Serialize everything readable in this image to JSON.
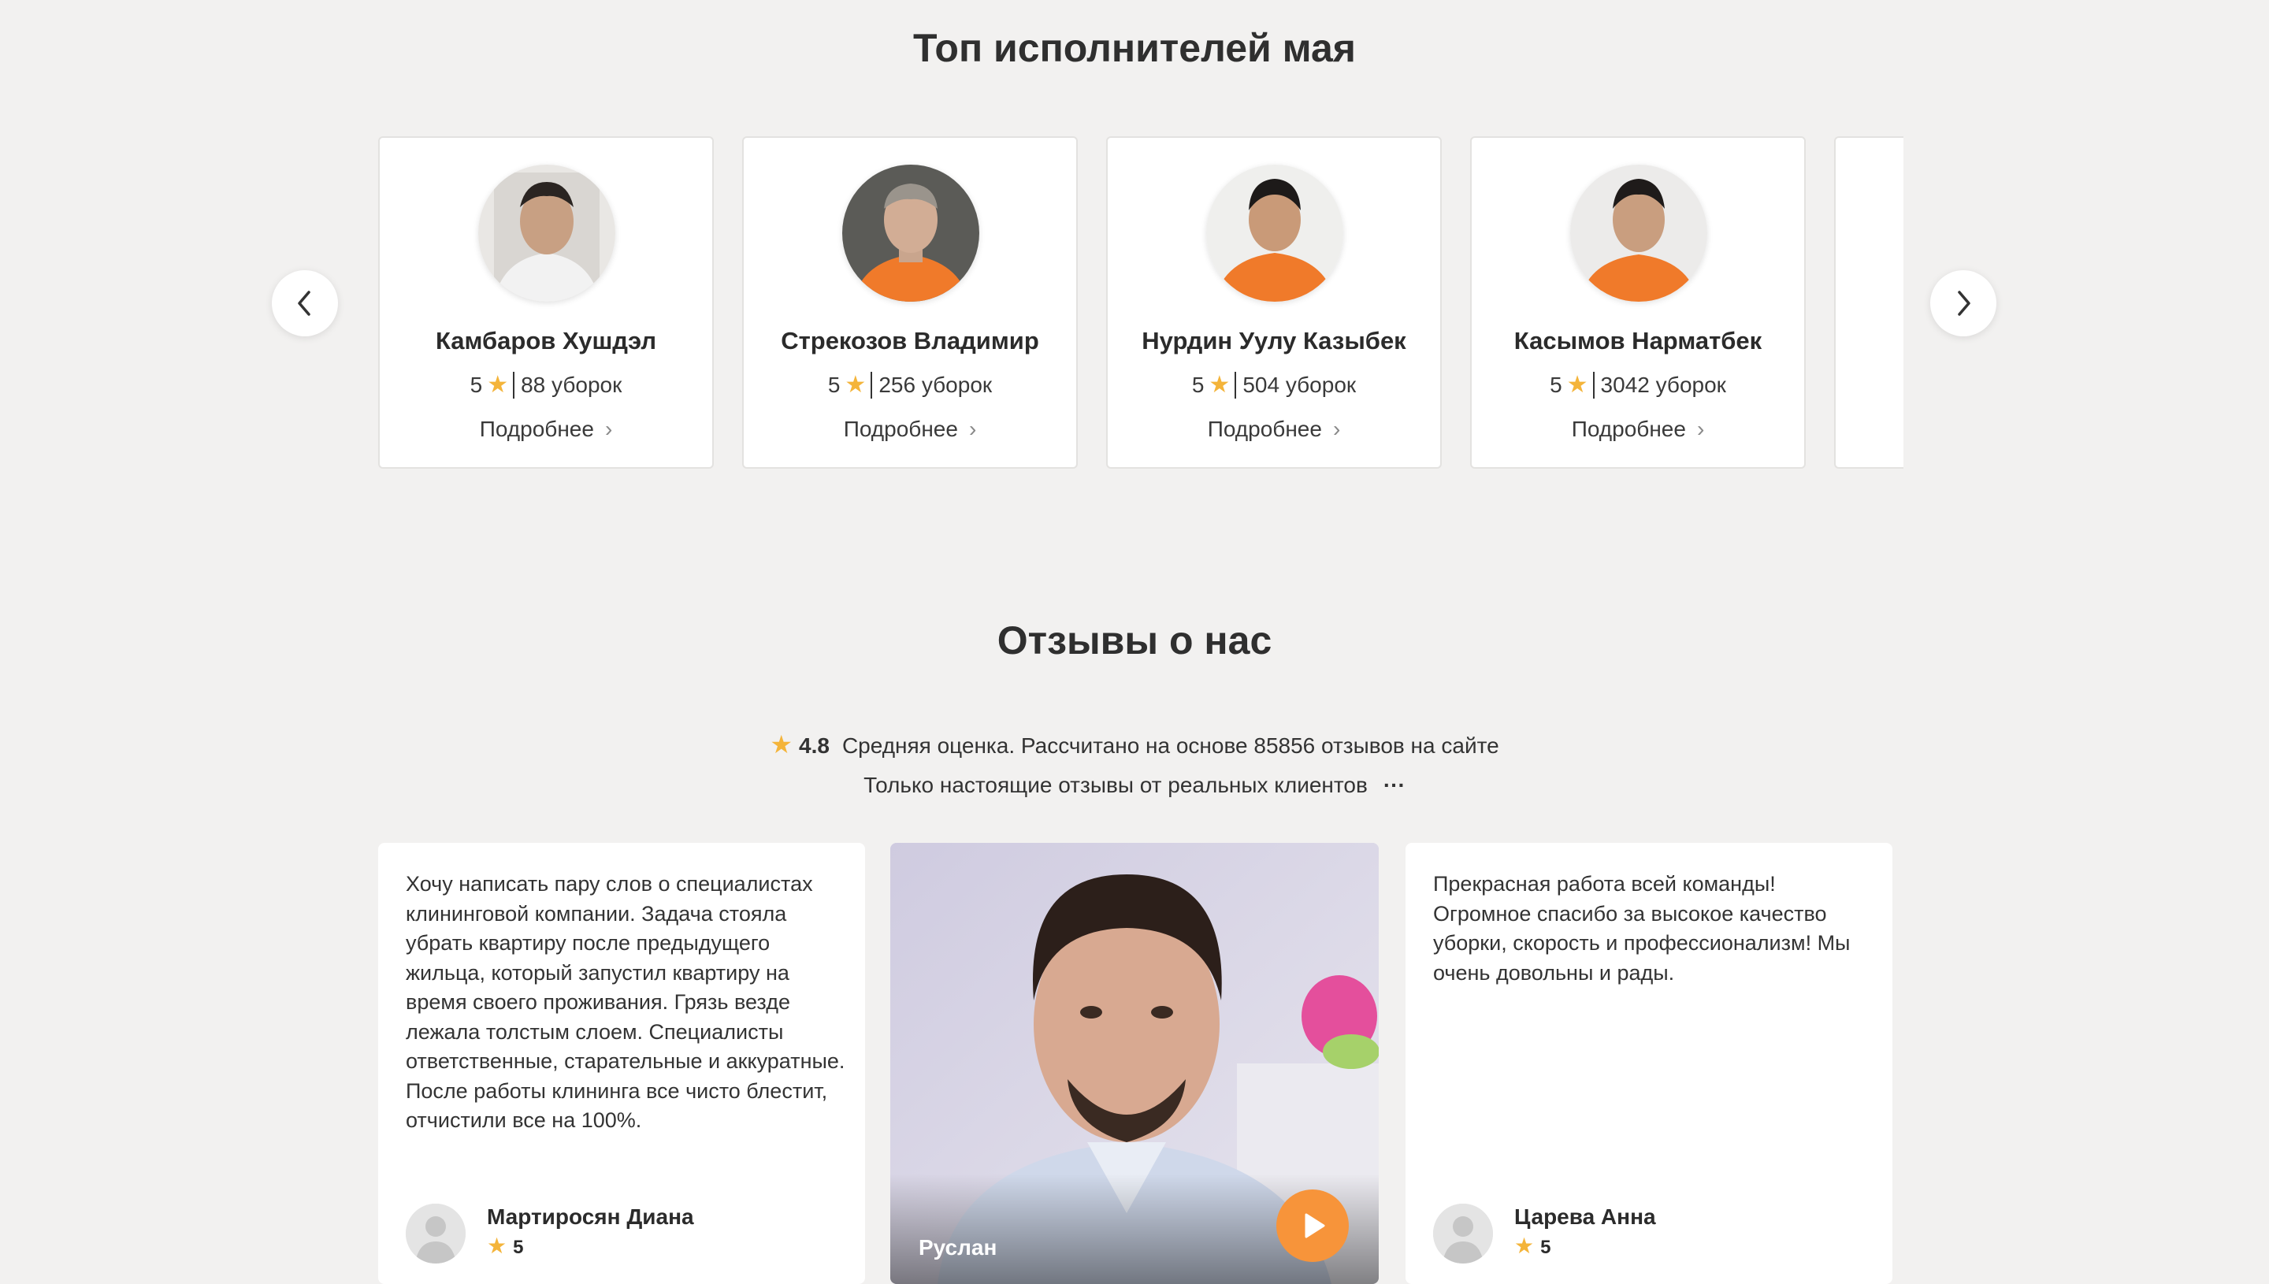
{
  "top_section": {
    "title": "Топ исполнителей мая",
    "performers": [
      {
        "name": "Камбаров Хушдэл",
        "rating": "5",
        "count": "88 уборок",
        "more": "Подробнее",
        "shirt_color": "#f2f2f2"
      },
      {
        "name": "Стрекозов Владимир",
        "rating": "5",
        "count": "256 уборок",
        "more": "Подробнее",
        "shirt_color": "#f07a2a"
      },
      {
        "name": "Нурдин Уулу Казыбек",
        "rating": "5",
        "count": "504 уборок",
        "more": "Подробнее",
        "shirt_color": "#f07a2a"
      },
      {
        "name": "Касымов Нарматбек",
        "rating": "5",
        "count": "3042 уборок",
        "more": "Подробнее",
        "shirt_color": "#f07a2a"
      }
    ],
    "prev_icon": "chevron-left-icon",
    "next_icon": "chevron-right-icon"
  },
  "reviews_section": {
    "title": "Отзывы о нас",
    "average": "4.8",
    "average_text": "Средняя оценка. Рассчитано на основе 85856 отзывов на сайте",
    "genuine_text": "Только настоящие отзывы от реальных клиентов",
    "more_icon": "···",
    "reviews": [
      {
        "text": "Хочу написать пару слов о специалистах клининговой компании. Задача стояла убрать квартиру после предыдущего жильца, который запустил квартиру на время своего проживания. Грязь везде лежала толстым слоем. Специалисты ответственные, старательные и аккуратные. После работы клининга все чисто блестит, отчистили все на 100%.",
        "author": "Мартиросян Диана",
        "rating": "5"
      },
      {
        "video_author": "Руслан"
      },
      {
        "text": "Прекрасная работа всей команды! Огромное спасибо за высокое качество уборки, скорость и профессионализм! Мы очень довольны и рады.",
        "author": "Царева Анна",
        "rating": "5"
      }
    ]
  },
  "colors": {
    "background": "#f2f1f0",
    "star": "#f4b43a",
    "play": "#f7943a"
  }
}
